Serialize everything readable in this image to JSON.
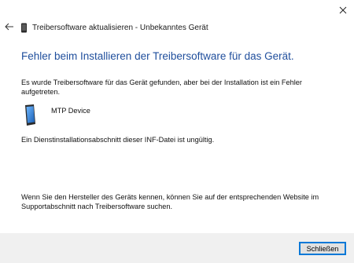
{
  "header": {
    "title": "Treibersoftware aktualisieren - Unbekanntes Gerät",
    "icon": "device-icon"
  },
  "main": {
    "heading": "Fehler beim Installieren der Treibersoftware für das Gerät.",
    "paragraph1": "Es wurde Treibersoftware für das Gerät gefunden, aber bei der Installation ist ein Fehler aufgetreten.",
    "device": {
      "name": "MTP Device",
      "icon": "mobile-device-icon"
    },
    "paragraph2": "Ein Dienstinstallationsabschnitt dieser INF-Datei ist ungültig.",
    "paragraph3": "Wenn Sie den Hersteller des Geräts kennen, können Sie auf der entsprechenden Website im Supportabschnitt nach Treibersoftware suchen."
  },
  "footer": {
    "close_label": "Schließen"
  },
  "colors": {
    "heading": "#1f4e9c",
    "footer_bg": "#f0f0f0",
    "button_border": "#0078d7"
  }
}
